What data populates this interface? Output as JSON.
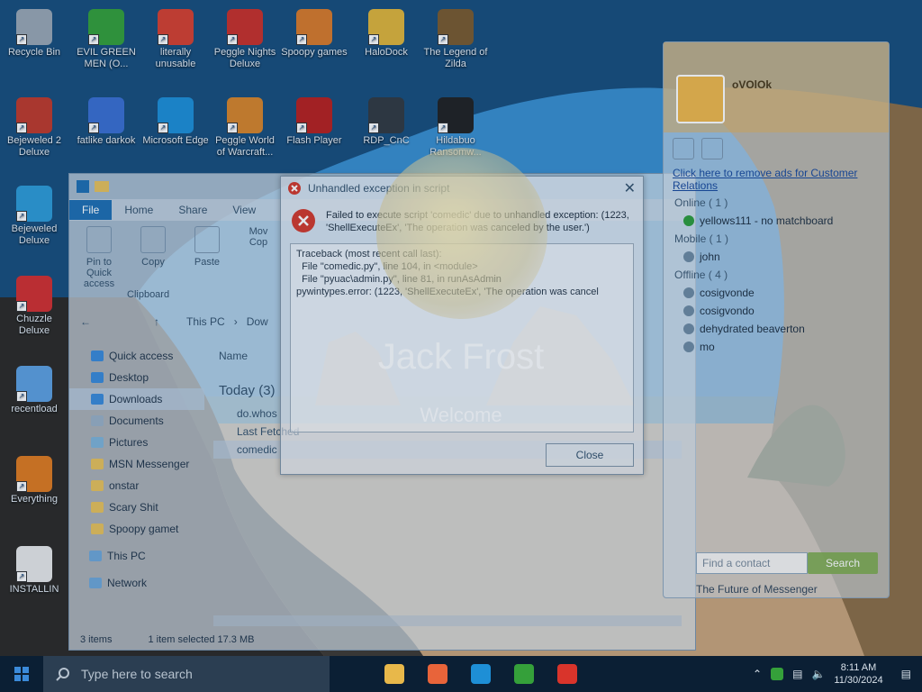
{
  "desktop_icons": [
    {
      "label": "Recycle Bin",
      "icon": "recycle-bin-icon",
      "color": "#9aa7b3"
    },
    {
      "label": "EVIL GREEN MEN (O...",
      "icon": "green-men-icon",
      "color": "#35a03a"
    },
    {
      "label": "literally unusable",
      "icon": "chrome-icon",
      "color": "#d6402f"
    },
    {
      "label": "Peggle Nights Deluxe",
      "icon": "peggle-nights-icon",
      "color": "#c9302a"
    },
    {
      "label": "Spoopy games",
      "icon": "spoopy-games-icon",
      "color": "#d97a2a"
    },
    {
      "label": "HaloDock",
      "icon": "halodock-shield-icon",
      "color": "#e0b43a"
    },
    {
      "label": "The Legend of Zilda",
      "icon": "zilda-icon",
      "color": "#7a5a2e"
    },
    {
      "label": "Bejeweled 2 Deluxe",
      "icon": "bejeweled-2-icon",
      "color": "#c0392b"
    },
    {
      "label": "fatlike darkok",
      "icon": "mpl-icon",
      "color": "#3b6fd1"
    },
    {
      "label": "Microsoft Edge",
      "icon": "edge-icon",
      "color": "#1e8fd6"
    },
    {
      "label": "Peggle World of Warcraft...",
      "icon": "peggle-wow-icon",
      "color": "#d8842a"
    },
    {
      "label": "Flash Player",
      "icon": "flash-player-icon",
      "color": "#b8201e"
    },
    {
      "label": "RDP_CnC",
      "icon": "rdp-icon",
      "color": "#333a40"
    },
    {
      "label": "Hildabuo Ransomw...",
      "icon": "ransomware-icon",
      "color": "#222"
    },
    {
      "label": "Bejeweled Deluxe",
      "icon": "bejeweled-icon",
      "color": "#2e9bd6"
    },
    {
      "label": "Chuzzle Deluxe",
      "icon": "chuzzle-icon",
      "color": "#d32f2f"
    },
    {
      "label": "recentload",
      "icon": "recentload-icon",
      "color": "#5ea0e0"
    },
    {
      "label": "Everything",
      "icon": "everything-icon",
      "color": "#e07a1e"
    },
    {
      "label": "INSTALLIN",
      "icon": "install-text-icon",
      "color": "#e8e8e8"
    }
  ],
  "explorer": {
    "tabs": [
      "File",
      "Home",
      "Share",
      "View"
    ],
    "ribbon": {
      "pin": "Pin to Quick access",
      "copy": "Copy",
      "paste": "Paste",
      "move": "Mov",
      "copy2": "Cop",
      "group": "Clipboard"
    },
    "address": "This PC",
    "address_next": "Dow",
    "nav": {
      "quick_access": "Quick access",
      "desktop": "Desktop",
      "downloads": "Downloads",
      "documents": "Documents",
      "pictures": "Pictures",
      "msn": "MSN Messenger",
      "onstar": "onstar",
      "scary": "Scary Shit",
      "spoopy": "Spoopy gamet",
      "thispc": "This PC",
      "network": "Network"
    },
    "column_name": "Name",
    "group_today": "Today (3)",
    "files": [
      "do.whos",
      "Last Fetched",
      "comedic"
    ],
    "status": {
      "items": "3 items",
      "selected": "1 item selected  17.3 MB"
    }
  },
  "error_dialog": {
    "title": "Unhandled exception in script",
    "message": "Failed to execute script 'comedic' due to unhandled exception: (1223, 'ShellExecuteEx', 'The operation was canceled by the user.')",
    "traceback": "Traceback (most recent call last):\n  File \"comedic.py\", line 104, in <module>\n  File \"pyuac\\admin.py\", line 81, in runAsAdmin\npywintypes.error: (1223, 'ShellExecuteEx', 'The operation was cancel",
    "close_label": "Close"
  },
  "messenger": {
    "username": "oVOlOk",
    "ad_text": "Click here to remove ads for Customer Relations",
    "groups": [
      {
        "label": "Online ( 1 )",
        "contacts": [
          {
            "name": "yellows111 - no matchboard",
            "online": true
          }
        ]
      },
      {
        "label": "Mobile ( 1 )",
        "contacts": [
          {
            "name": "john",
            "online": false
          }
        ]
      },
      {
        "label": "Offline ( 4 )",
        "contacts": [
          {
            "name": "cosigvonde",
            "online": false
          },
          {
            "name": "cosigvondo",
            "online": false
          },
          {
            "name": "dehydrated beaverton",
            "online": false
          },
          {
            "name": "mo",
            "online": false
          }
        ]
      }
    ],
    "search_placeholder": "Find a contact",
    "search_button": "Search",
    "footer": "The Future of Messenger"
  },
  "lockscreen": {
    "name": "Jack Frost",
    "welcome": "Welcome"
  },
  "taskbar": {
    "search_placeholder": "Type here to search",
    "apps": [
      {
        "icon": "file-explorer-icon",
        "color": "#e8b84a"
      },
      {
        "icon": "firefox-icon",
        "color": "#e8643a"
      },
      {
        "icon": "edge-taskbar-icon",
        "color": "#1e8fd6"
      },
      {
        "icon": "green-men-taskbar-icon",
        "color": "#35a03a"
      },
      {
        "icon": "error-taskbar-icon",
        "color": "#d9342b"
      }
    ],
    "time": "8:11 AM",
    "date": "11/30/2024"
  }
}
